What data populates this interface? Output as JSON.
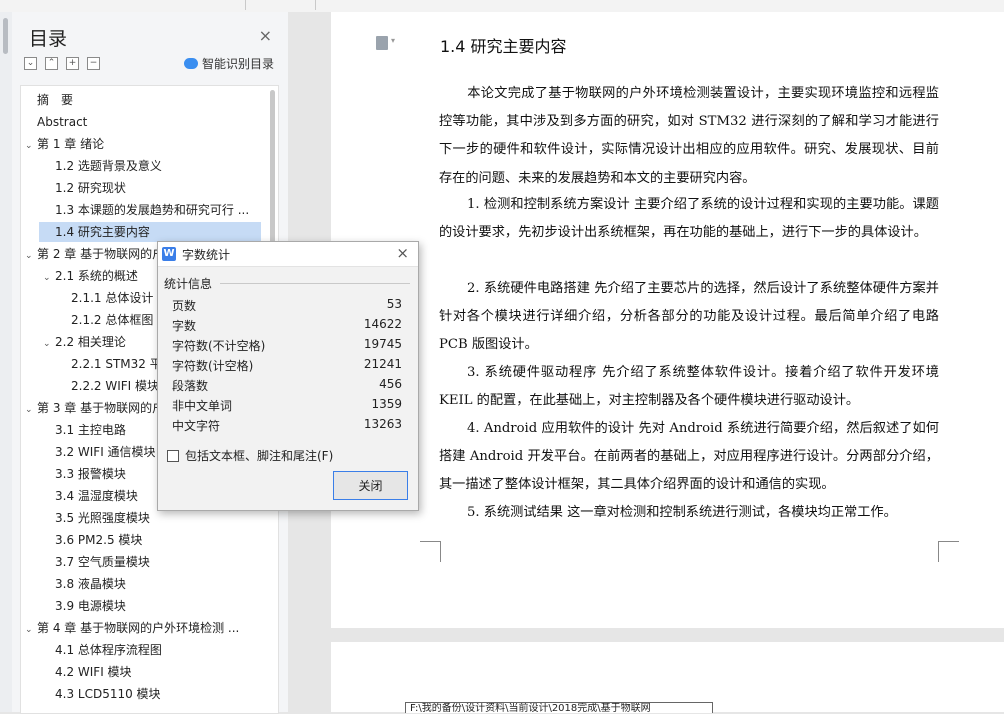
{
  "toc": {
    "title": "目录",
    "close_glyph": "×",
    "smart_label": "智能识别目录",
    "tool_glyphs": [
      "⌄",
      "⌃",
      "+",
      "−"
    ],
    "items": [
      {
        "label": "摘　要",
        "level": 1,
        "chev": ""
      },
      {
        "label": "Abstract",
        "level": 1,
        "chev": ""
      },
      {
        "label": "第 1 章  绪论",
        "level": 1,
        "chev": "v"
      },
      {
        "label": "1.2  选题背景及意义",
        "level": 2,
        "chev": ""
      },
      {
        "label": "1.2  研究现状",
        "level": 2,
        "chev": ""
      },
      {
        "label": "1.3 本课题的发展趋势和研究可行 ...",
        "level": 2,
        "chev": ""
      },
      {
        "label": "1.4 研究主要内容",
        "level": 2,
        "chev": "",
        "active": true
      },
      {
        "label": "第 2 章  基于物联网的户外环境检...",
        "level": 1,
        "chev": "v"
      },
      {
        "label": "2.1  系统的概述",
        "level": 2,
        "chev": "v"
      },
      {
        "label": "2.1.1  总体设计",
        "level": 3,
        "chev": ""
      },
      {
        "label": "2.1.2  总体框图",
        "level": 3,
        "chev": ""
      },
      {
        "label": "2.2  相关理论",
        "level": 2,
        "chev": "v"
      },
      {
        "label": "2.2.1 STM32 平台",
        "level": 3,
        "chev": ""
      },
      {
        "label": "2.2.2 WIFI 模块",
        "level": 3,
        "chev": ""
      },
      {
        "label": "第 3 章  基于物联网的户外环境检...",
        "level": 1,
        "chev": "v"
      },
      {
        "label": "3.1  主控电路",
        "level": 2,
        "chev": ""
      },
      {
        "label": "3.2 WIFI 通信模块",
        "level": 2,
        "chev": ""
      },
      {
        "label": "3.3 报警模块",
        "level": 2,
        "chev": ""
      },
      {
        "label": "3.4 温湿度模块",
        "level": 2,
        "chev": ""
      },
      {
        "label": "3.5  光照强度模块",
        "level": 2,
        "chev": ""
      },
      {
        "label": "3.6 PM2.5 模块",
        "level": 2,
        "chev": ""
      },
      {
        "label": "3.7  空气质量模块",
        "level": 2,
        "chev": ""
      },
      {
        "label": "3.8 液晶模块",
        "level": 2,
        "chev": ""
      },
      {
        "label": "3.9 电源模块",
        "level": 2,
        "chev": ""
      },
      {
        "label": "第 4 章  基于物联网的户外环境检测 ...",
        "level": 1,
        "chev": "v"
      },
      {
        "label": "4.1  总体程序流程图",
        "level": 2,
        "chev": ""
      },
      {
        "label": "4.2 WIFI 模块",
        "level": 2,
        "chev": ""
      },
      {
        "label": "4.3 LCD5110 模块",
        "level": 2,
        "chev": ""
      }
    ]
  },
  "document": {
    "heading": "1.4 研究主要内容",
    "paragraphs": [
      "本论文完成了基于物联网的户外环境检测装置设计，主要实现环境监控和远程监控等功能，其中涉及到多方面的研究，如对 STM32 进行深刻的了解和学习才能进行下一步的硬件和软件设计，实际情况设计出相应的应用软件。研究、发展现状、目前存在的问题、未来的发展趋势和本文的主要研究内容。",
      "1. 检测和控制系统方案设计  主要介绍了系统的设计过程和实现的主要功能。课题的设计要求，先初步设计出系统框架，再在功能的基础上，进行下一步的具体设计。",
      "2. 系统硬件电路搭建 先介绍了主要芯片的选择，然后设计了系统整体硬件方案并针对各个模块进行详细介绍，分析各部分的功能及设计过程。最后简单介绍了电路 PCB 版图设计。",
      "3. 系统硬件驱动程序 先介绍了系统整体软件设计。接着介绍了软件开发环境 KEIL 的配置，在此基础上，对主控制器及各个硬件模块进行驱动设计。",
      "4. Android 应用软件的设计 先对 Android 系统进行简要介绍，然后叙述了如何搭建 Android 开发平台。在前两者的基础上，对应用程序进行设计。分两部分介绍，其一描述了整体设计框架，其二具体介绍界面的设计和通信的实现。",
      "5. 系统测试结果 这一章对检测和控制系统进行测试，各模块均正常工作。"
    ],
    "status_text": "F:\\我的备份\\设计资料\\当前设计\\2018完成\\基于物联网"
  },
  "dialog": {
    "logo": "W",
    "title": "字数统计",
    "close_glyph": "×",
    "section_label": "统计信息",
    "stats": [
      {
        "label": "页数",
        "value": "53"
      },
      {
        "label": "字数",
        "value": "14622"
      },
      {
        "label": "字符数(不计空格)",
        "value": "19745"
      },
      {
        "label": "字符数(计空格)",
        "value": "21241"
      },
      {
        "label": "段落数",
        "value": "456"
      },
      {
        "label": "非中文单词",
        "value": "1359"
      },
      {
        "label": "中文字符",
        "value": "13263"
      }
    ],
    "checkbox_label": "包括文本框、脚注和尾注(F)",
    "checkbox_checked": false,
    "close_button": "关闭"
  }
}
